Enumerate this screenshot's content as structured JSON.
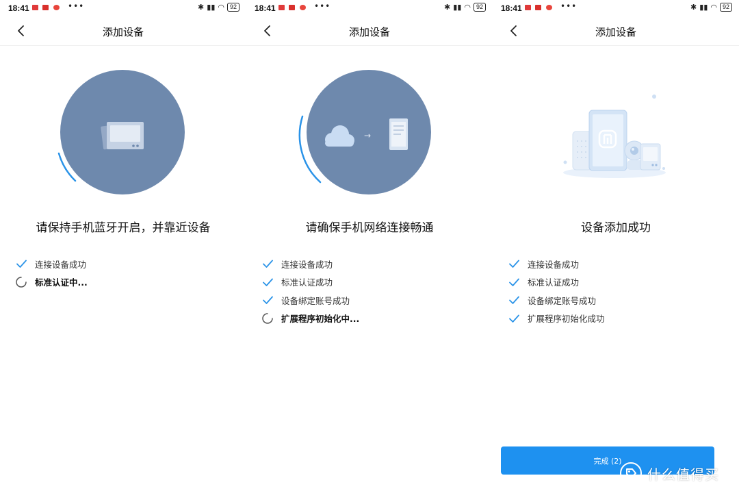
{
  "colors": {
    "accent": "#1e91f0",
    "circle": "#6e89ad",
    "check": "#2a93e8"
  },
  "screens": [
    {
      "status": {
        "time": "18:41",
        "battery": "92"
      },
      "title": "添加设备",
      "headline": "请保持手机蓝牙开启，并靠近设备",
      "steps": [
        {
          "label": "连接设备成功",
          "state": "done"
        },
        {
          "label": "标准认证中...",
          "state": "pending"
        }
      ]
    },
    {
      "status": {
        "time": "18:41",
        "battery": "92"
      },
      "title": "添加设备",
      "headline": "请确保手机网络连接畅通",
      "steps": [
        {
          "label": "连接设备成功",
          "state": "done"
        },
        {
          "label": "标准认证成功",
          "state": "done"
        },
        {
          "label": "设备绑定账号成功",
          "state": "done"
        },
        {
          "label": "扩展程序初始化中...",
          "state": "pending"
        }
      ]
    },
    {
      "status": {
        "time": "18:41",
        "battery": "92"
      },
      "title": "添加设备",
      "headline": "设备添加成功",
      "steps": [
        {
          "label": "连接设备成功",
          "state": "done"
        },
        {
          "label": "标准认证成功",
          "state": "done"
        },
        {
          "label": "设备绑定账号成功",
          "state": "done"
        },
        {
          "label": "扩展程序初始化成功",
          "state": "done"
        }
      ],
      "button": {
        "label": "完成 (2)"
      }
    }
  ],
  "watermark": {
    "icon": "price-tag-icon",
    "text": "什么值得买"
  }
}
